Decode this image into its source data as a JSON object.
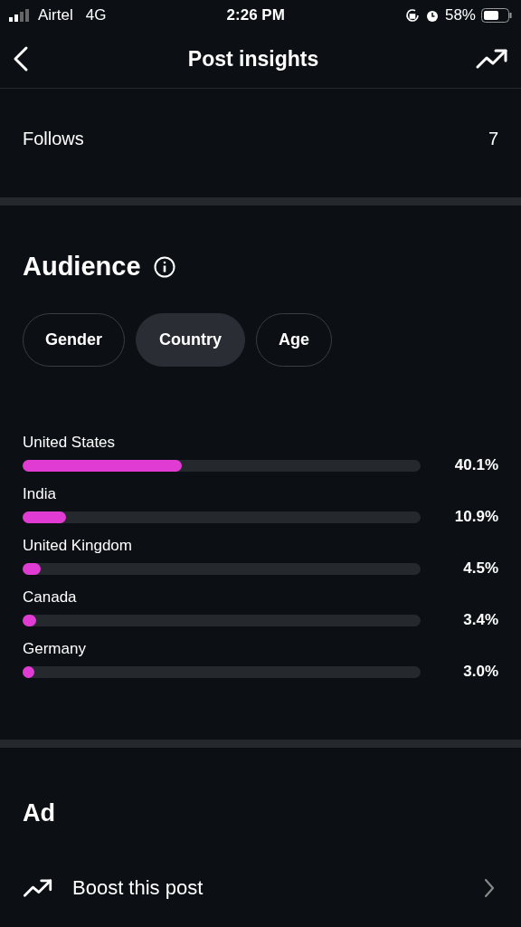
{
  "status_bar": {
    "carrier": "Airtel",
    "network": "4G",
    "time": "2:26 PM",
    "battery": "58%"
  },
  "header": {
    "title": "Post insights"
  },
  "metrics": [
    {
      "label": "Follows",
      "value": "7"
    }
  ],
  "audience": {
    "title": "Audience",
    "tabs": [
      {
        "label": "Gender",
        "selected": false
      },
      {
        "label": "Country",
        "selected": true
      },
      {
        "label": "Age",
        "selected": false
      }
    ],
    "rows": [
      {
        "name": "United States",
        "level": 0.401,
        "reading": "40.1%"
      },
      {
        "name": "India",
        "level": 0.109,
        "reading": "10.9%"
      },
      {
        "name": "United Kingdom",
        "level": 0.045,
        "reading": "4.5%"
      },
      {
        "name": "Canada",
        "level": 0.034,
        "reading": "3.4%"
      },
      {
        "name": "Germany",
        "level": 0.03,
        "reading": "3.0%"
      }
    ]
  },
  "ad": {
    "title": "Ad",
    "action": "Boost this post"
  }
}
